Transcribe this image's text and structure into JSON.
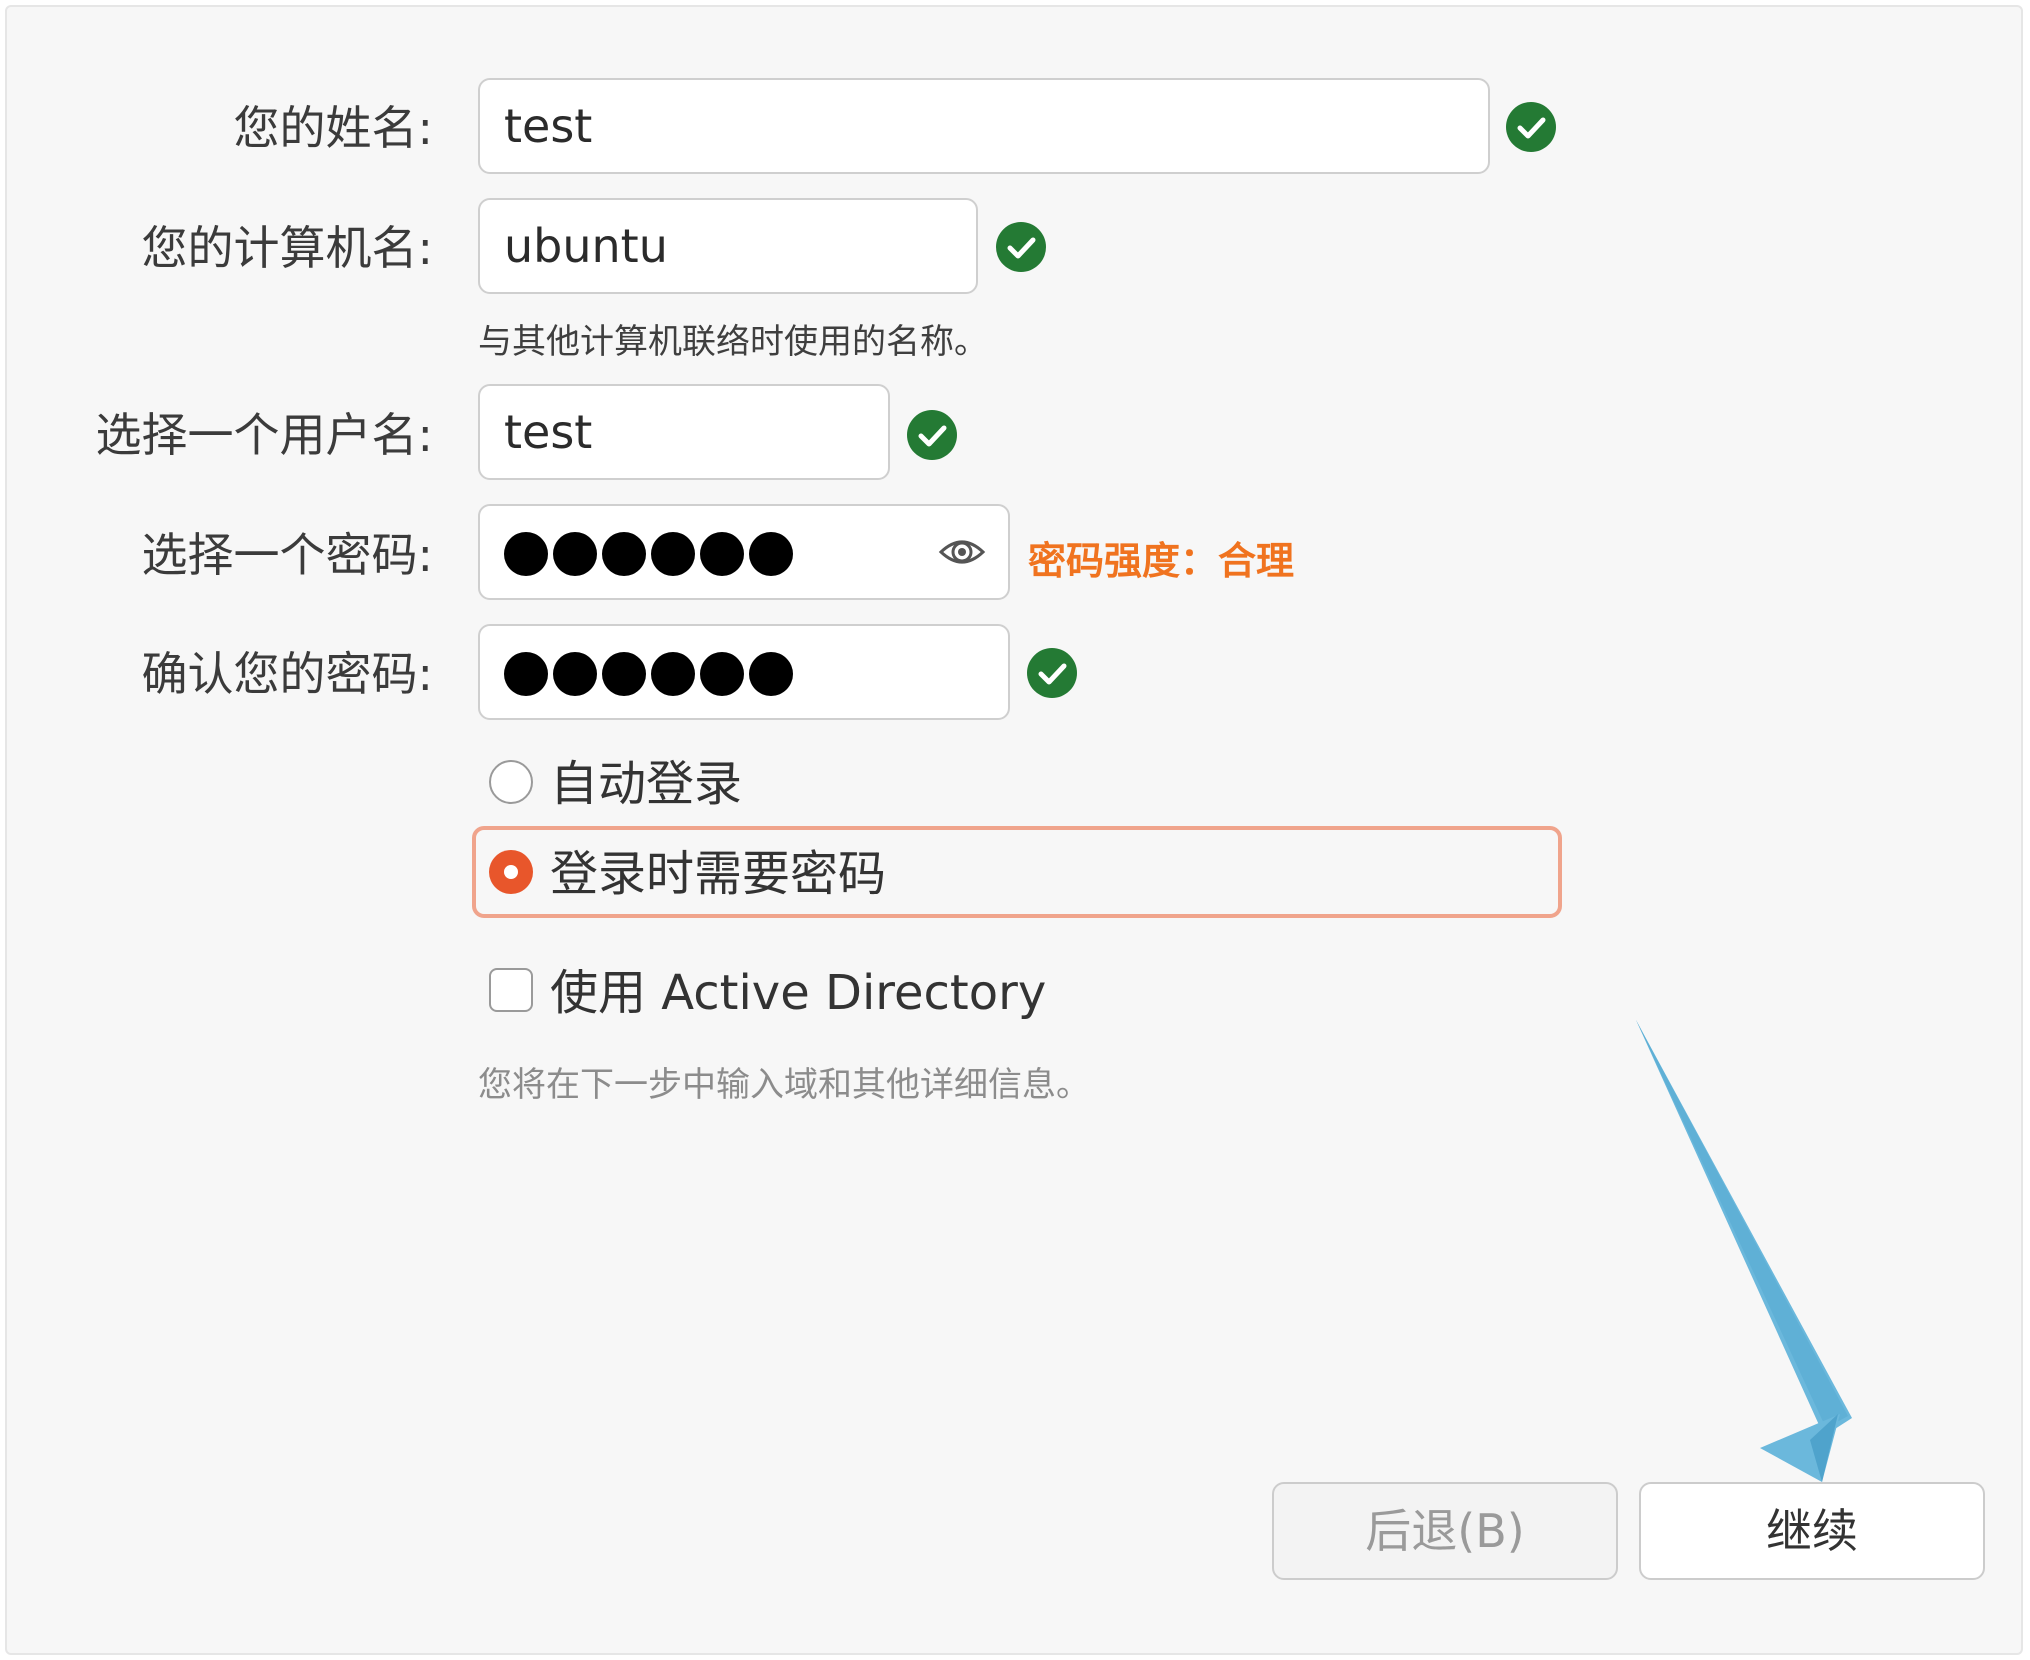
{
  "form": {
    "name_label": "您的姓名:",
    "name_value": "test",
    "computer_label": "您的计算机名:",
    "computer_value": "ubuntu",
    "computer_hint": "与其他计算机联络时使用的名称。",
    "username_label": "选择一个用户名:",
    "username_value": "test",
    "password_label": "选择一个密码:",
    "password_strength": "密码强度：合理",
    "confirm_label": "确认您的密码:"
  },
  "login_options": {
    "auto_login": "自动登录",
    "require_password": "登录时需要密码",
    "selected": "require_password"
  },
  "active_directory": {
    "label": "使用 Active Directory",
    "checked": false,
    "hint": "您将在下一步中输入域和其他详细信息。"
  },
  "buttons": {
    "back": "后退(B)",
    "continue": "继续"
  },
  "colors": {
    "valid": "#247a34",
    "strength": "#f0731f",
    "radio_selected": "#e8562b",
    "focus_ring": "#f0a48c",
    "annotation_arrow": "#6bb8dc"
  }
}
